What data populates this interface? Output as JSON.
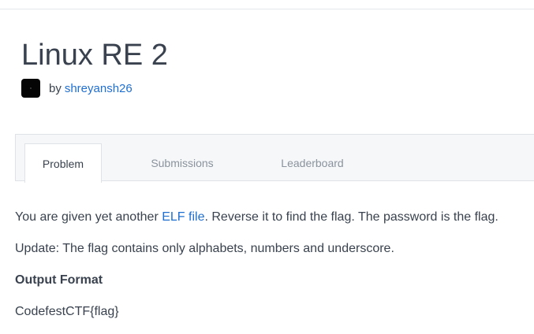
{
  "challenge": {
    "title": "Linux RE 2",
    "by_label": "by",
    "author": "shreyansh26"
  },
  "tabs": [
    {
      "label": "Problem",
      "active": true
    },
    {
      "label": "Submissions",
      "active": false
    },
    {
      "label": "Leaderboard",
      "active": false
    }
  ],
  "problem": {
    "intro_before": "You are given yet another ",
    "intro_link": "ELF file",
    "intro_after": ". Reverse it to find the flag. The password is the flag.",
    "update": "Update: The flag contains only alphabets, numbers and underscore.",
    "output_heading": "Output Format",
    "output_format": "CodefestCTF{flag}"
  },
  "colors": {
    "link": "#1f6fd1",
    "text": "#39424e",
    "muted_tab": "#8a939e"
  }
}
